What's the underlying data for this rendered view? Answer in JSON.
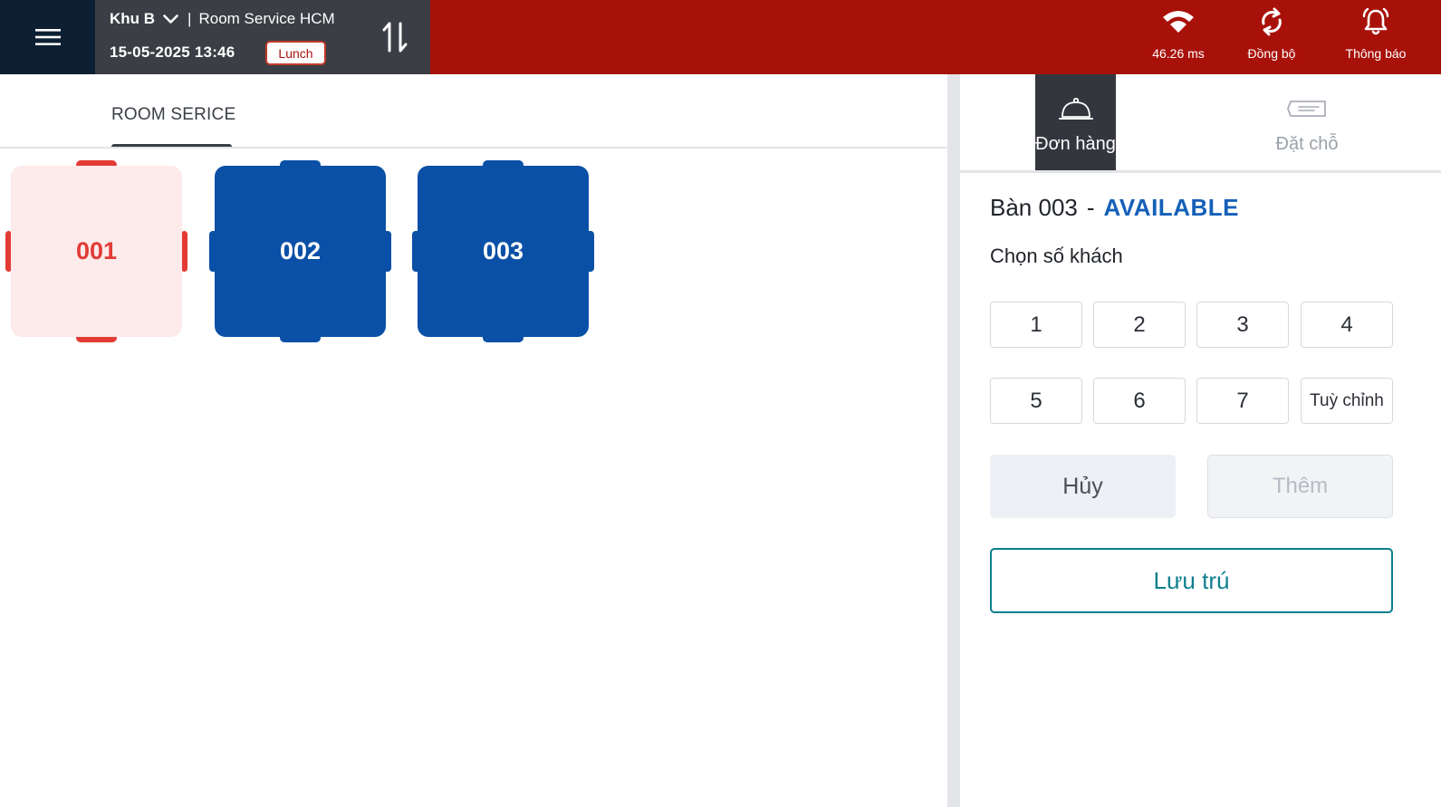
{
  "header": {
    "area": "Khu B",
    "separator": "|",
    "location": "Room Service HCM",
    "datetime": "15-05-2025 13:46",
    "shift": "Lunch",
    "status": {
      "ping": "46.26 ms",
      "sync": "Đồng bộ",
      "notify": "Thông báo"
    },
    "icons": {
      "menu": "hamburger-menu-icon",
      "chevron": "chevron-down-icon",
      "swap": "swap-vertical-icon",
      "wifi": "wifi-icon",
      "sync": "sync-icon",
      "bell": "bell-icon"
    }
  },
  "floor": {
    "tab": "ROOM SERICE",
    "tables": [
      {
        "name": "001",
        "state": "free"
      },
      {
        "name": "002",
        "state": "occupied"
      },
      {
        "name": "003",
        "state": "occupied"
      }
    ]
  },
  "panel": {
    "tabs": [
      {
        "label": "Đơn hàng",
        "icon": "cloche-icon",
        "active": true
      },
      {
        "label": "Đặt chỗ",
        "icon": "ticket-icon",
        "active": false
      }
    ],
    "table_label": "Bàn 003",
    "dash": "-",
    "table_status": "AVAILABLE",
    "guest_prompt": "Chọn số khách",
    "guest_options": [
      "1",
      "2",
      "3",
      "4",
      "5",
      "6",
      "7",
      "Tuỳ chỉnh"
    ],
    "cancel": "Hủy",
    "add": "Thêm",
    "stay": "Lưu trú"
  },
  "colors": {
    "header_red": "#a8110a",
    "menu_navy": "#0c1f33",
    "header_gray": "#3b3e44",
    "table_blue": "#0a50a6",
    "table_free_red": "#e23b35",
    "status_blue": "#1560b8",
    "teal": "#0e7e8e"
  }
}
